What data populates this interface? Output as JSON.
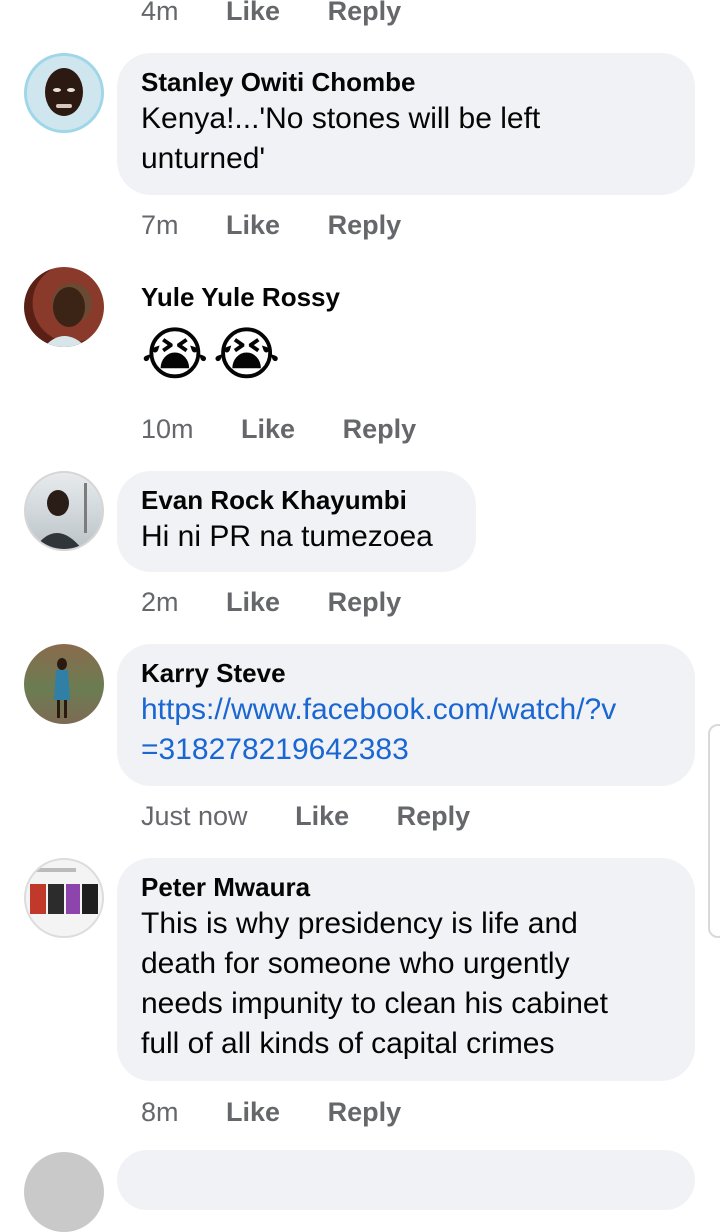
{
  "top_meta": {
    "time": "4m",
    "like": "Like",
    "reply": "Reply"
  },
  "comments": [
    {
      "name": "Stanley Owiti Chombe",
      "text_lines": [
        "Kenya!...'No stones will be left",
        "unturned'"
      ],
      "time": "7m",
      "like": "Like",
      "reply": "Reply"
    },
    {
      "name": "Yule Yule Rossy",
      "emoji": "😭😭",
      "time": "10m",
      "like": "Like",
      "reply": "Reply"
    },
    {
      "name": "Evan Rock Khayumbi",
      "text_lines": [
        "Hi ni PR na tumezoea"
      ],
      "time": "2m",
      "like": "Like",
      "reply": "Reply"
    },
    {
      "name": "Karry Steve",
      "link_lines": [
        "https://www.facebook.com/watch/?v",
        "=318278219642383"
      ],
      "time": "Just now",
      "like": "Like",
      "reply": "Reply"
    },
    {
      "name": "Peter Mwaura",
      "text_lines": [
        "This is why presidency is life and",
        "death for someone who urgently",
        "needs impunity to clean his cabinet",
        "full of all kinds of capital crimes"
      ],
      "time": "8m",
      "like": "Like",
      "reply": "Reply"
    }
  ],
  "colors": {
    "bubble": "#f0f2f5",
    "link": "#1a67d3",
    "meta": "#65676b"
  }
}
